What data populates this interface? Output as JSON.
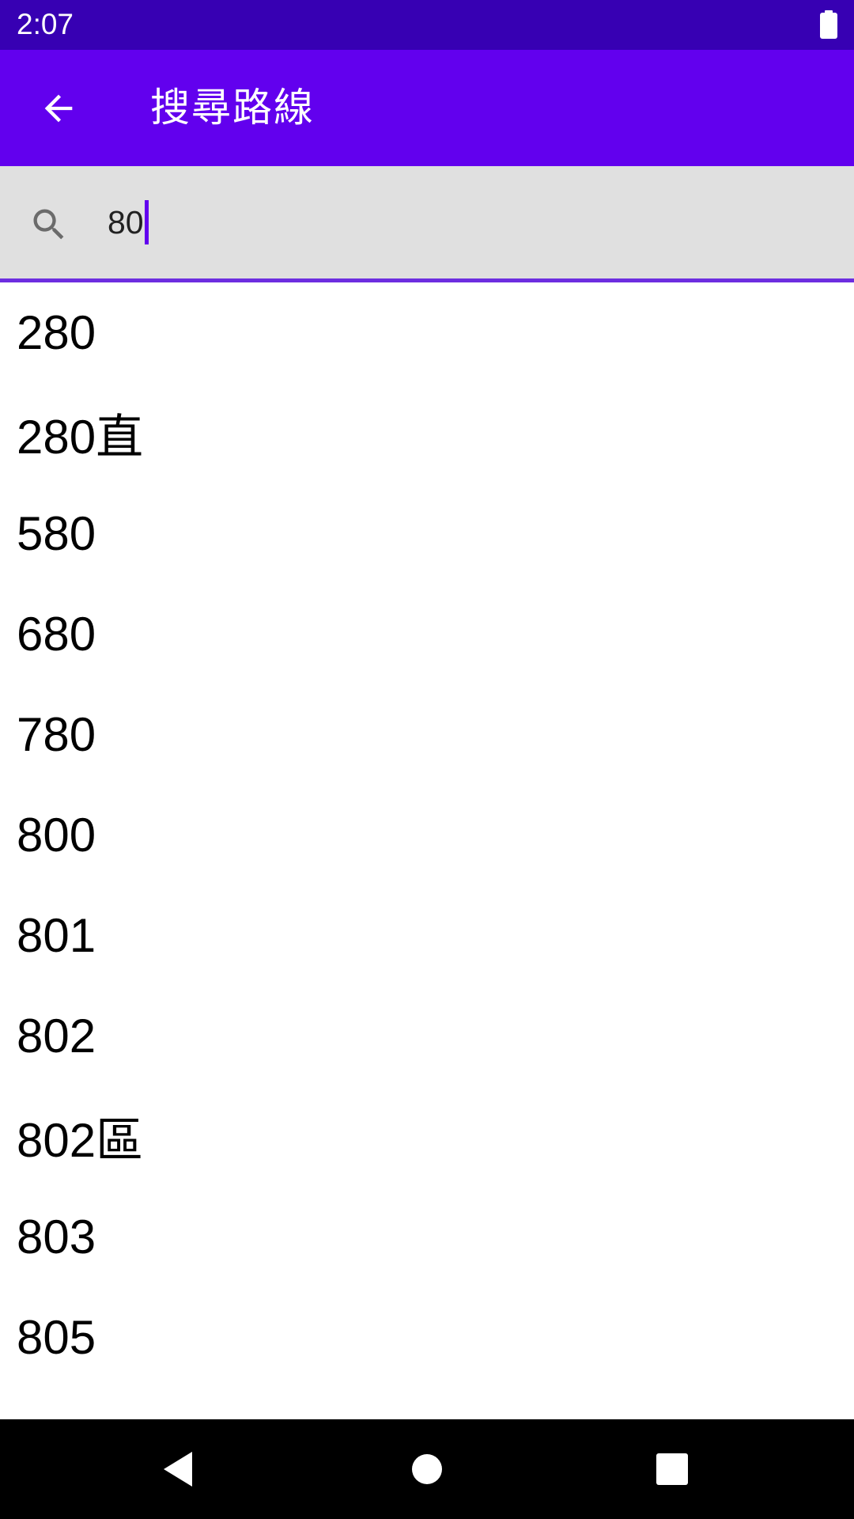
{
  "status_bar": {
    "time": "2:07",
    "battery_icon": "battery-full-icon"
  },
  "app_bar": {
    "back_icon": "arrow-back-icon",
    "title": "搜尋路線",
    "background_color": "#6200ee"
  },
  "search": {
    "icon": "search-icon",
    "value": "80",
    "accent_color": "#6200ee"
  },
  "results": [
    {
      "label": "280"
    },
    {
      "label": "280直"
    },
    {
      "label": "580"
    },
    {
      "label": "680"
    },
    {
      "label": "780"
    },
    {
      "label": "800"
    },
    {
      "label": "801"
    },
    {
      "label": "802"
    },
    {
      "label": "802區"
    },
    {
      "label": "803"
    },
    {
      "label": "805"
    }
  ],
  "nav_bar": {
    "back": "nav-back-icon",
    "home": "nav-home-icon",
    "recents": "nav-recents-icon"
  }
}
